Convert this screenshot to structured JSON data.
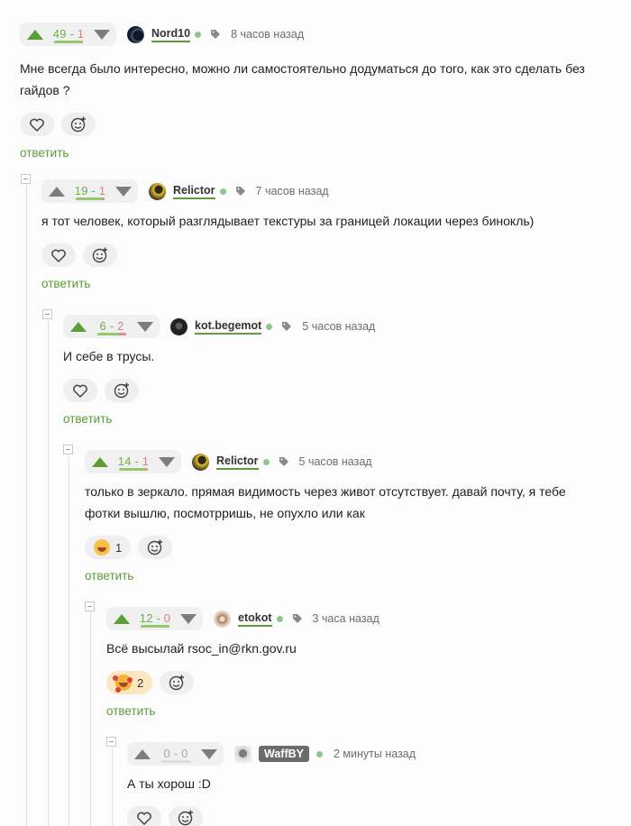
{
  "comments": [
    {
      "score_plus": "49",
      "score_sep": " - ",
      "score_minus": "1",
      "author": "Nord10",
      "time": "8 часов назад",
      "text": "Мне всегда было интересно, можно ли самостоятельно додуматься до того, как это сделать без гайдов ?",
      "reply": "ответить",
      "reaction_count": ""
    },
    {
      "score_plus": "19",
      "score_sep": " - ",
      "score_minus": "1",
      "author": "Relictor",
      "time": "7 часов назад",
      "text": "я тот человек, который разглядывает текстуры за границей локации через бинокль)",
      "reply": "ответить",
      "reaction_count": ""
    },
    {
      "score_plus": "6",
      "score_sep": " - ",
      "score_minus": "2",
      "author": "kot.begemot",
      "time": "5 часов назад",
      "text": "И себе в трусы.",
      "reply": "ответить",
      "reaction_count": ""
    },
    {
      "score_plus": "14",
      "score_sep": " - ",
      "score_minus": "1",
      "author": "Relictor",
      "time": "5 часов назад",
      "text": "только в зеркало. прямая видимость через живот отсутствует. давай почту, я тебе фотки вышлю, посмотрришь, не опухло или как",
      "reply": "ответить",
      "reaction_count": "1"
    },
    {
      "score_plus": "12",
      "score_sep": " - ",
      "score_minus": "0",
      "author": "etokot",
      "time": "3 часа назад",
      "text": "Всё высылай rsoc_in@rkn.gov.ru",
      "reply": "ответить",
      "reaction_count": "2"
    },
    {
      "score_plus": "0",
      "score_sep": " - ",
      "score_minus": "0",
      "author": "WaffBY",
      "time": "2 минуты назад",
      "text": "А ты хорош :D",
      "reply": "",
      "reaction_count": ""
    }
  ],
  "colors": {
    "accent": "#5b9e37",
    "downvote": "#e88c8c",
    "online": "#8cc88c"
  },
  "icons": [
    "arrow-up-icon",
    "arrow-down-icon",
    "tag-icon",
    "heart-icon",
    "add-reaction-icon",
    "laugh-emoji-icon",
    "love-emoji-icon"
  ]
}
